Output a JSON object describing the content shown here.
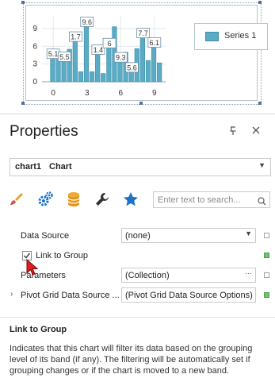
{
  "chart": {
    "series_name": "Series 1",
    "bar_color": "#5aabc5"
  },
  "chart_data": {
    "type": "bar",
    "x": [
      0,
      1,
      2,
      3,
      4,
      5,
      6,
      7,
      8,
      9,
      10,
      11,
      12,
      13,
      14,
      15,
      16,
      17,
      18,
      19
    ],
    "values": [
      4.2,
      5.1,
      3.7,
      5.5,
      7.1,
      1.7,
      9.6,
      1.7,
      4.9,
      1.4,
      6.0,
      9.3,
      3.6,
      5.0,
      1.9,
      5.6,
      7.7,
      3.6,
      6.1,
      3.2
    ],
    "data_labels": [
      {
        "x": 0,
        "text": "5.1"
      },
      {
        "x": 1,
        "text": "5.5"
      },
      {
        "x": 2,
        "text": "1.7"
      },
      {
        "x": 3,
        "text": "9.6"
      },
      {
        "x": 4,
        "text": "1.4"
      },
      {
        "x": 5,
        "text": "6"
      },
      {
        "x": 6,
        "text": "9.3"
      },
      {
        "x": 7,
        "text": "5.6"
      },
      {
        "x": 8,
        "text": "7.7"
      },
      {
        "x": 9,
        "text": "6.1"
      }
    ],
    "x_ticks": [
      "0",
      "3",
      "6",
      "9"
    ],
    "y_ticks": [
      "0",
      "3",
      "6",
      "9"
    ],
    "xlim": [
      -1,
      10
    ],
    "ylim": [
      0,
      11
    ],
    "legend": [
      "Series 1"
    ],
    "legend_position": "right",
    "grid": true
  },
  "panel": {
    "title": "Properties",
    "pin_icon": "pin-icon",
    "close_icon": "close-icon",
    "object_name": "chart1",
    "object_type": "Chart",
    "search_placeholder": "Enter text to search...",
    "toolbar": [
      "appearance-brush-icon",
      "behavior-gears-icon",
      "data-database-icon",
      "actions-wrench-icon",
      "favorites-star-icon"
    ]
  },
  "props": {
    "data_source": {
      "label": "Data Source",
      "value": "(none)"
    },
    "link_to_group": {
      "label": "Link to Group",
      "checked": true
    },
    "parameters": {
      "label": "Parameters",
      "value": "(Collection)",
      "button": "···"
    },
    "pivot": {
      "label": "Pivot Grid Data Source ...",
      "value": "(Pivot Grid Data Source Options)"
    }
  },
  "description": {
    "title": "Link to Group",
    "text": "Indicates that this chart will filter its data based on the grouping level of its band (if any).  The filtering will be automatically set if grouping changes or if the chart is moved to a new band."
  },
  "colors": {
    "brush_red": "#d9534f",
    "accent_blue": "#1a73c7",
    "marker_green": "#6fc26f"
  }
}
